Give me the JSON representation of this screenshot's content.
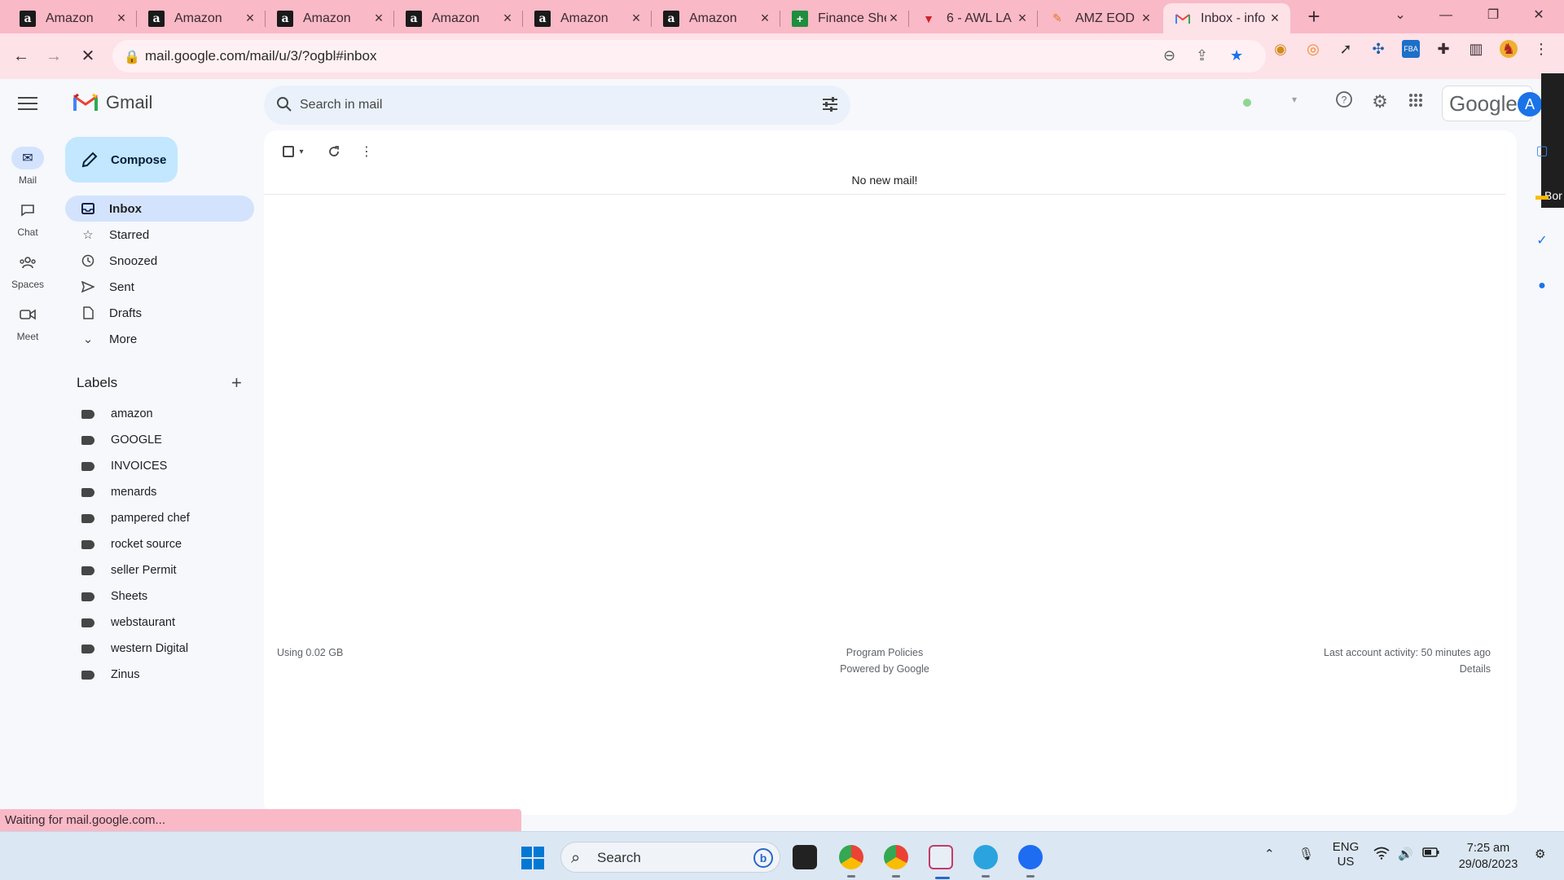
{
  "browser": {
    "tabs": [
      {
        "title": "Amazon",
        "icon": "amazon-icon",
        "favicon_text": "a"
      },
      {
        "title": "Amazon",
        "icon": "amazon-icon",
        "favicon_text": "a"
      },
      {
        "title": "Amazon",
        "icon": "amazon-icon",
        "favicon_text": "a"
      },
      {
        "title": "Amazon",
        "icon": "amazon-icon",
        "favicon_text": "a"
      },
      {
        "title": "Amazon",
        "icon": "amazon-icon",
        "favicon_text": "a"
      },
      {
        "title": "Amazon",
        "icon": "amazon-icon",
        "favicon_text": "a"
      },
      {
        "title": "Finance She",
        "icon": "sheets-icon"
      },
      {
        "title": "6 - AWL LA",
        "icon": "v-logo-icon"
      },
      {
        "title": "AMZ EOD R",
        "icon": "pen-logo-icon"
      },
      {
        "title": "Inbox - info",
        "icon": "gmail-icon",
        "active": true
      }
    ],
    "url": "mail.google.com/mail/u/3/?ogbl#inbox",
    "loading_status": "Waiting for mail.google.com...",
    "theme_color": "#f9b9c7"
  },
  "gmail": {
    "app_name": "Gmail",
    "search_placeholder": "Search in mail",
    "google_word": "Google",
    "avatar_letter": "A",
    "overlay_text": "Bor",
    "rail": [
      {
        "label": "Mail",
        "icon": "mail-icon",
        "active": true
      },
      {
        "label": "Chat",
        "icon": "chat-icon"
      },
      {
        "label": "Spaces",
        "icon": "spaces-icon"
      },
      {
        "label": "Meet",
        "icon": "meet-icon"
      }
    ],
    "compose_label": "Compose",
    "nav": [
      {
        "label": "Inbox",
        "icon": "inbox-icon",
        "active": true
      },
      {
        "label": "Starred",
        "icon": "star-icon"
      },
      {
        "label": "Snoozed",
        "icon": "clock-icon"
      },
      {
        "label": "Sent",
        "icon": "send-icon"
      },
      {
        "label": "Drafts",
        "icon": "draft-icon"
      },
      {
        "label": "More",
        "icon": "chevron-down-icon"
      }
    ],
    "labels_title": "Labels",
    "labels": [
      "amazon",
      "GOOGLE",
      "INVOICES",
      "menards",
      "pampered chef",
      "rocket source",
      "seller Permit",
      "Sheets",
      "webstaurant",
      "western Digital",
      "Zinus"
    ],
    "empty_message": "No new mail!",
    "footer": {
      "storage": "Using 0.02 GB",
      "policies": "Program Policies",
      "powered": "Powered by Google",
      "activity": "Last account activity: 50 minutes ago",
      "details": "Details"
    },
    "accent_color": "#d3e3fd",
    "compose_color": "#c2e7ff"
  },
  "taskbar": {
    "search_label": "Search",
    "language": "ENG",
    "region": "US",
    "time": "7:25 am",
    "date": "29/08/2023"
  }
}
